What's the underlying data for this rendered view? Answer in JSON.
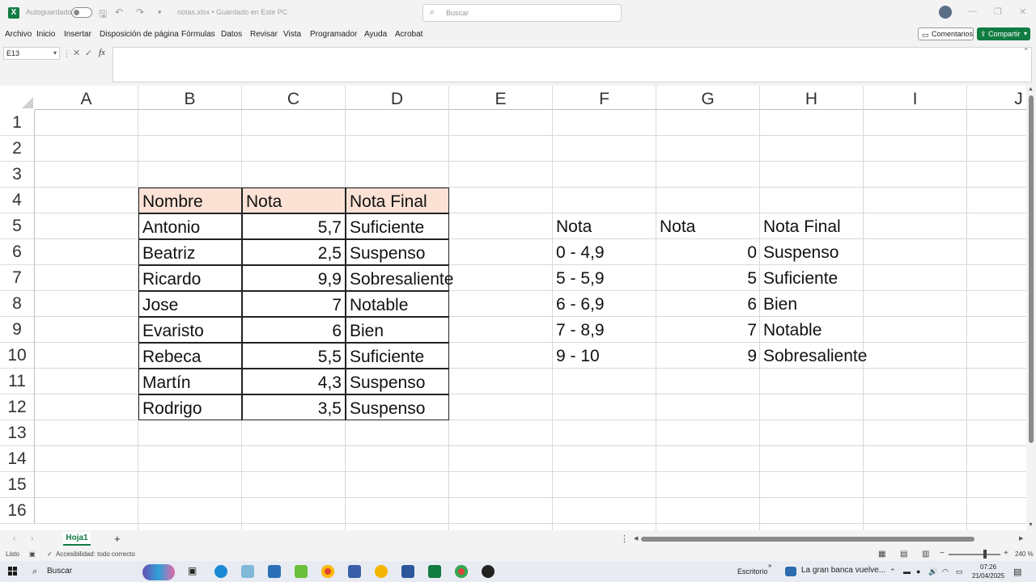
{
  "titlebar": {
    "autosave_label": "Autoguardado",
    "filename": "notas.xlsx • Guardado en Este PC",
    "search_placeholder": "Buscar",
    "window_controls": [
      "minimize-icon",
      "restore-icon",
      "close-icon"
    ]
  },
  "menu": {
    "items": [
      "Archivo",
      "Inicio",
      "Insertar",
      "Disposición de página",
      "Fórmulas",
      "Datos",
      "Revisar",
      "Vista",
      "Programador",
      "Ayuda",
      "Acrobat"
    ],
    "comments_label": "Comentarios",
    "share_label": "Compartir"
  },
  "formula_bar": {
    "name_box": "E13",
    "fx_label": "fx",
    "formula": ""
  },
  "grid": {
    "columns": [
      "A",
      "B",
      "C",
      "D",
      "E",
      "F",
      "G",
      "H",
      "I",
      "J"
    ],
    "rows": [
      "1",
      "2",
      "3",
      "4",
      "5",
      "6",
      "7",
      "8",
      "9",
      "10",
      "11",
      "12",
      "13",
      "14",
      "15",
      "16"
    ],
    "table1": {
      "headers": [
        "Nombre",
        "Nota",
        "Nota Final"
      ],
      "rows": [
        [
          "Antonio",
          "5,7",
          "Suficiente"
        ],
        [
          "Beatriz",
          "2,5",
          "Suspenso"
        ],
        [
          "Ricardo",
          "9,9",
          "Sobresaliente"
        ],
        [
          "Jose",
          "7",
          "Notable"
        ],
        [
          "Evaristo",
          "6",
          "Bien"
        ],
        [
          "Rebeca",
          "5,5",
          "Suficiente"
        ],
        [
          "Martín",
          "4,3",
          "Suspenso"
        ],
        [
          "Rodrigo",
          "3,5",
          "Suspenso"
        ]
      ]
    },
    "table2": {
      "headers": [
        "Nota",
        "Nota",
        "Nota Final"
      ],
      "rows": [
        [
          "0 - 4,9",
          "0",
          "Suspenso"
        ],
        [
          "5 - 5,9",
          "5",
          "Suficiente"
        ],
        [
          "6 - 6,9",
          "6",
          "Bien"
        ],
        [
          "7 - 8,9",
          "7",
          "Notable"
        ],
        [
          "9 - 10",
          "9",
          "Sobresaliente"
        ]
      ]
    },
    "header_fill_color": "#fbe2d5"
  },
  "sheets": {
    "tabs": [
      "Hoja1"
    ],
    "active": "Hoja1"
  },
  "status": {
    "ready": "Listo",
    "accessibility": "Accesibilidad: todo correcto",
    "zoom": "240 %"
  },
  "taskbar": {
    "search_label": "Buscar",
    "desktop_label": "Escritorio",
    "news": "La gran banca vuelve...",
    "time": "07:26",
    "date": "21/04/2025",
    "apps": [
      "task-view-icon",
      "edge-icon",
      "paint-icon",
      "store-icon",
      "notepad-icon",
      "chrome-icon",
      "remote-desktop-icon",
      "folder-icon",
      "word-icon",
      "excel-icon",
      "chrome-profile-icon",
      "obs-icon"
    ]
  },
  "colors": {
    "excel_green": "#107c41",
    "chrome_bg": "#f3f3f3"
  }
}
